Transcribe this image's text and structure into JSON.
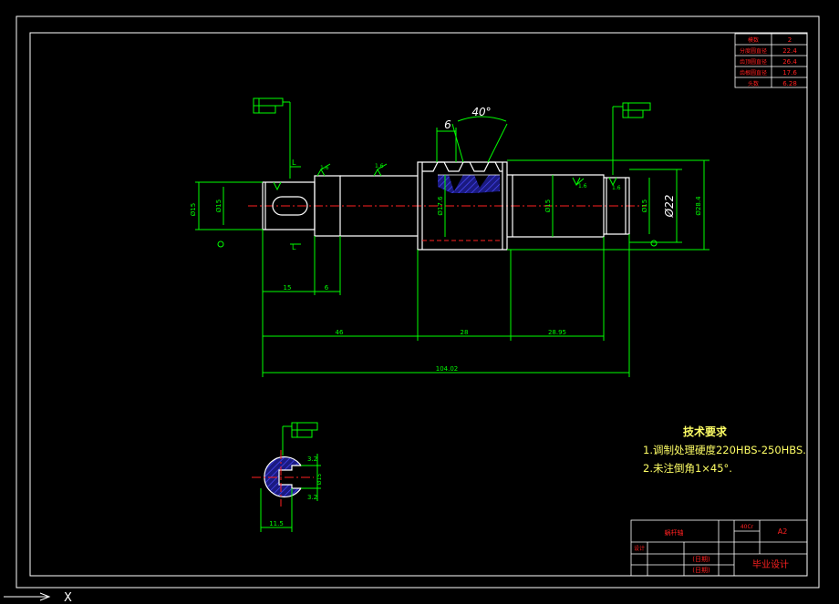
{
  "drawing": {
    "tech_requirements": {
      "title": "技术要求",
      "line1": "1.调制处理硬度220HBS-250HBS.",
      "line2": "2.未注倒角1×45°."
    },
    "dimensions": {
      "d_keyway_len": "15",
      "d_keyway_gap": "6",
      "d_left_len": "46",
      "d_worm_len": "28",
      "d_right_len": "28.95",
      "d_total_len": "104.02",
      "d_pitch": "6",
      "d_angle": "40°",
      "d_dia22": "Ø22",
      "d_od": "Ø28.4",
      "d_root": "Ø17.6",
      "d_left_dia": "Ø15",
      "d_sec_w": "11.5",
      "d_sec_h1": "3.2",
      "d_sec_h2": "3.2",
      "d_rough1": "1.6",
      "d_rough2": "1.6",
      "d_rough3": "1.6",
      "d_rough4": "1.6",
      "section_mark": "L"
    },
    "param_table": {
      "rows": [
        {
          "label": "模数",
          "value": "2"
        },
        {
          "label": "分度圆直径",
          "value": "22.4"
        },
        {
          "label": "齿顶圆直径",
          "value": "26.4"
        },
        {
          "label": "齿根圆直径",
          "value": "17.6"
        },
        {
          "label": "头数",
          "value": "6.28"
        }
      ]
    },
    "title_block": {
      "part_name": "蜗杆轴",
      "material": "40Cr",
      "scale": "A2",
      "designer_label": "设计",
      "school_label": "毕业设计",
      "date_label": "(日期)"
    }
  },
  "status": {
    "axis_x_label": "X"
  }
}
